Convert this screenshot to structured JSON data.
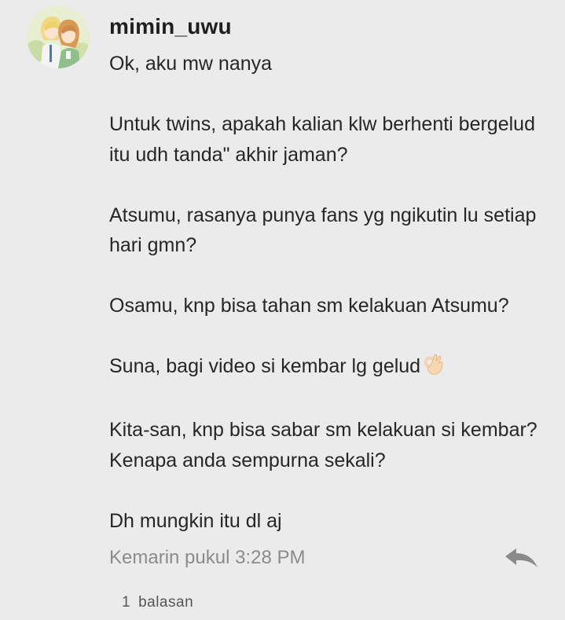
{
  "comment": {
    "avatar_icon": "avatar-anime-twins",
    "username": "mimin_uwu",
    "paragraphs": [
      "Ok, aku mw nanya",
      "Untuk twins, apakah kalian klw berhenti bergelud\nitu udh tanda\" akhir jaman?",
      "Atsumu, rasanya punya fans yg ngikutin lu setiap\nhari gmn?",
      "Osamu, knp bisa tahan sm kelakuan Atsumu?",
      "Suna, bagi video si kembar lg gelud",
      "Kita-san, knp bisa sabar sm kelakuan si kembar?\nKenapa anda sempurna sekali?",
      "Dh mungkin itu dl aj"
    ],
    "emoji_icon": "ok-hand-emoji",
    "timestamp": "Kemarin pukul 3:28 PM",
    "reply_icon": "reply-arrow-icon",
    "replies_count": "1",
    "replies_label": "balasan"
  },
  "colors": {
    "background": "#ebebeb",
    "text": "#262626",
    "muted": "#8b8b8b",
    "icon": "#8a8a8a"
  }
}
